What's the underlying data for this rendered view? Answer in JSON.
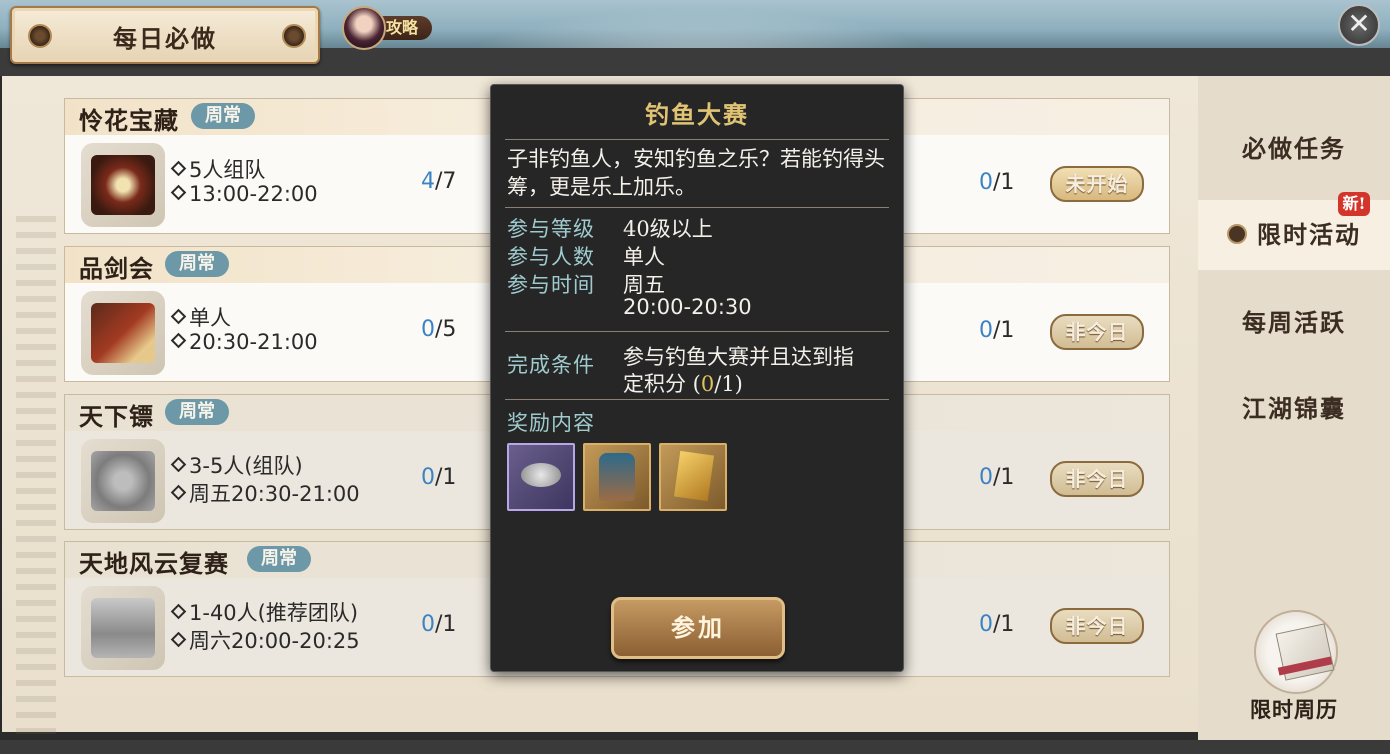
{
  "header": {
    "title": "每日必做",
    "guide_label": "攻略",
    "close_symbol": "✕"
  },
  "activities": [
    {
      "name": "怜花宝藏",
      "tag": "周常",
      "line1": "5人组队",
      "line2": "13:00-22:00",
      "done": "4",
      "total": "/7"
    },
    {
      "name": "品剑会",
      "tag": "周常",
      "line1": "单人",
      "line2": "20:30-21:00",
      "done": "0",
      "total": "/5"
    },
    {
      "name": "天下镖",
      "tag": "周常",
      "line1": "3-5人(组队)",
      "line2": "周五20:30-21:00",
      "done": "0",
      "total": "/1"
    },
    {
      "name": "天地风云复赛",
      "tag": "周常",
      "line1": "1-40人(推荐团队)",
      "line2": "周六20:00-20:25",
      "done": "0",
      "total": "/1"
    }
  ],
  "right_column": [
    {
      "done": "0",
      "total": "/1",
      "button": "未开始"
    },
    {
      "done": "0",
      "total": "/1",
      "button": "非今日"
    },
    {
      "done": "0",
      "total": "/1",
      "button": "非今日"
    },
    {
      "done": "0",
      "total": "/1",
      "button": "非今日"
    }
  ],
  "menu": {
    "items": [
      "必做任务",
      "限时活动",
      "每周活跃",
      "江湖锦囊"
    ],
    "active": "限时活动",
    "new_badge": "新!",
    "calendar_label": "限时周历"
  },
  "popup": {
    "title": "钓鱼大赛",
    "description": "子非钓鱼人，安知钓鱼之乐？若能钓得头筹，更是乐上加乐。",
    "level_label": "参与等级",
    "level_value": "40级以上",
    "people_label": "参与人数",
    "people_value": "单人",
    "time_label": "参与时间",
    "time_day": "周五",
    "time_range": "20:00-20:30",
    "condition_label": "完成条件",
    "condition_text_1": "参与钓鱼大赛并且达到指",
    "condition_text_2": "定积分 (",
    "condition_progress": "0",
    "condition_total": "/1)",
    "reward_label": "奖励内容",
    "rewards": [
      "silver-coins-icon",
      "robe-icon",
      "card-icon"
    ],
    "join_button": "参加"
  },
  "colors": {
    "tag": "#6c98a8",
    "progress": "#3b83c4",
    "popup_title": "#e1c374",
    "popup_key": "#9fcbcf",
    "new_badge": "#d3352b"
  }
}
